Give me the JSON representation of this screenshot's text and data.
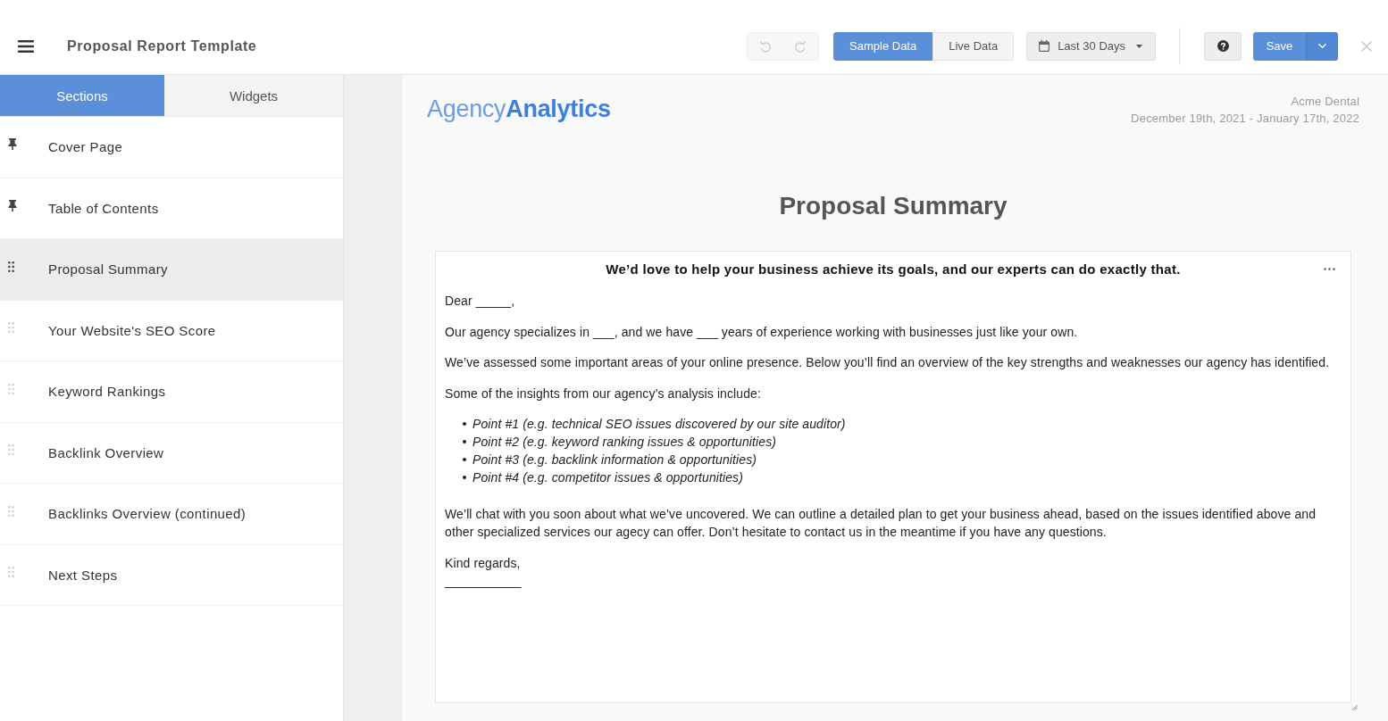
{
  "top_bar": {
    "title": "Proposal Report Template",
    "history": [
      {
        "kind": "undo",
        "disabled": true
      },
      {
        "kind": "redo",
        "disabled": true
      }
    ],
    "data_source": [
      {
        "label": "Sample Data",
        "selected": true
      },
      {
        "label": "Live Data",
        "selected": false
      }
    ],
    "date_range": "Last 30 Days",
    "save": "Save"
  },
  "sidebar": {
    "tabs": [
      {
        "label": "Sections",
        "selected": true
      },
      {
        "label": "Widgets",
        "selected": false
      }
    ],
    "sections": [
      {
        "label": "Cover Page",
        "kind": "pinned",
        "selected": false
      },
      {
        "label": "Table of Contents",
        "kind": "pinned",
        "selected": false
      },
      {
        "label": "Proposal Summary",
        "kind": "movable",
        "selected": true
      },
      {
        "label": "Your Website's SEO Score",
        "kind": "movable",
        "selected": false
      },
      {
        "label": "Keyword Rankings",
        "kind": "movable",
        "selected": false
      },
      {
        "label": "Backlink Overview",
        "kind": "movable",
        "selected": false
      },
      {
        "label": "Backlinks Overview (continued)",
        "kind": "movable",
        "selected": false
      },
      {
        "label": "Next Steps",
        "kind": "movable",
        "selected": false
      }
    ]
  },
  "report": {
    "logo": "Agency**Analytics**",
    "client": "Acme Dental",
    "period": "December 19th, 2021 - January 17th, 2022",
    "title": "Proposal Summary",
    "text_block": {
      "heading": "We’d love to help your business achieve its goals, and our experts can do exactly that.",
      "body": [
        {
          "kind": "paragraph",
          "text": "Dear _____,"
        },
        {
          "kind": "paragraph",
          "text": "Our agency specializes in ___, and we have ___ years of experience working with businesses just like your own."
        },
        {
          "kind": "paragraph",
          "text": "We’ve assessed some important areas of your online presence. Below you’ll find an overview of the key strengths and weaknesses our agency has identified."
        },
        {
          "kind": "paragraph",
          "text": "Some of the insights from our agency’s analysis include:"
        },
        {
          "kind": "list",
          "items": [
            "Point #1 (e.g. technical SEO issues discovered by our site auditor)",
            "Point #2 (e.g. keyword ranking issues & opportunities)",
            "Point #3 (e.g. backlink information & opportunities)",
            "Point #4 (e.g. competitor issues & opportunities)"
          ]
        },
        {
          "kind": "paragraph",
          "text": "We’ll chat with you soon about what we’ve uncovered. We can outline a detailed plan to get your business ahead, based on the issues identified above and other specialized services our agecy can offer. Don’t hesitate to contact us in the meantime if you have any questions."
        },
        {
          "kind": "paragraph",
          "text": "Kind regards,"
        },
        {
          "kind": "signature",
          "text": "___________"
        }
      ]
    }
  }
}
